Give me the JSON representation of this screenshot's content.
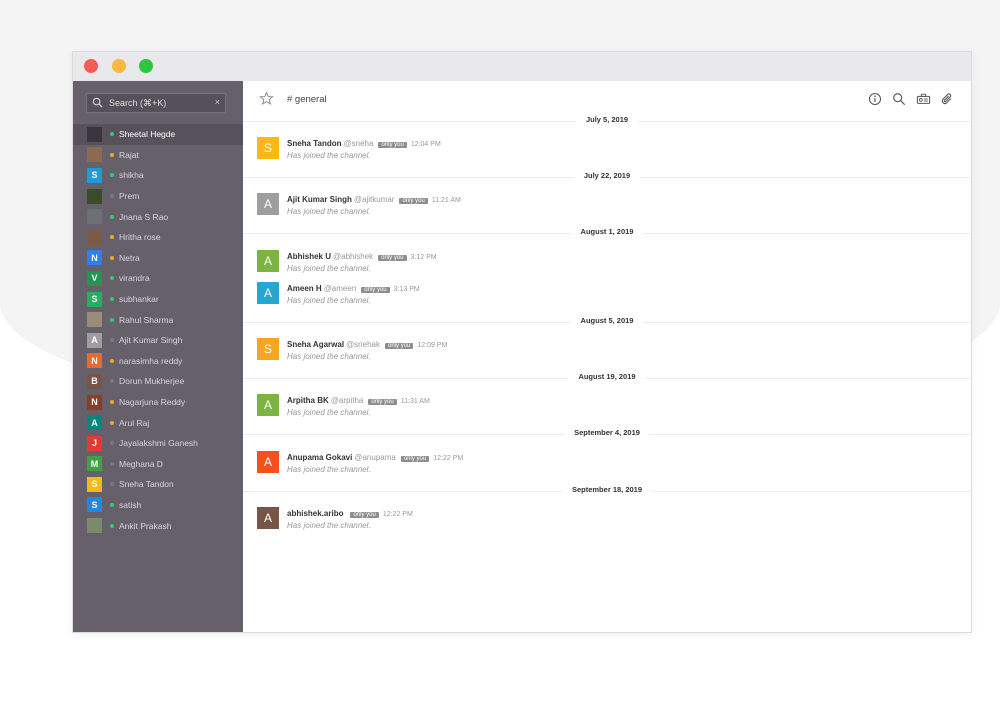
{
  "sidebar": {
    "search_placeholder": "Search (⌘+K)",
    "search_clear": "×",
    "dms": [
      {
        "name": "Sheetal Hegde",
        "avatar_letter": "",
        "avatar_color": "#3a3540",
        "status_color": "#2ecc71",
        "active": true
      },
      {
        "name": "Rajat",
        "avatar_letter": "",
        "avatar_color": "#8a6a50",
        "status_color": "#f5a623"
      },
      {
        "name": "shikha",
        "avatar_letter": "S",
        "avatar_color": "#1b9be0",
        "status_color": "#2ecc71"
      },
      {
        "name": "Prem",
        "avatar_letter": "",
        "avatar_color": "#3c4a2c",
        "status_color": "#7c7780"
      },
      {
        "name": "Jnana S Rao",
        "avatar_letter": "",
        "avatar_color": "#6d6f73",
        "status_color": "#2ecc71"
      },
      {
        "name": "Hritha rose",
        "avatar_letter": "",
        "avatar_color": "#7b5a4a",
        "status_color": "#f5a623"
      },
      {
        "name": "Netra",
        "avatar_letter": "N",
        "avatar_color": "#2f80ed",
        "status_color": "#f5a623"
      },
      {
        "name": "virandra",
        "avatar_letter": "V",
        "avatar_color": "#219653",
        "status_color": "#2ecc71"
      },
      {
        "name": "subhankar",
        "avatar_letter": "S",
        "avatar_color": "#27ae60",
        "status_color": "#2ecc71"
      },
      {
        "name": "Rahul Sharma",
        "avatar_letter": "",
        "avatar_color": "#9b8b7a",
        "status_color": "#2ecc71"
      },
      {
        "name": "Ajit Kumar Singh",
        "avatar_letter": "A",
        "avatar_color": "#9e9e9e",
        "status_color": "#7c7780"
      },
      {
        "name": "narasimha reddy",
        "avatar_letter": "N",
        "avatar_color": "#e96b2b",
        "status_color": "#f5a623"
      },
      {
        "name": "Dorun Mukherjee",
        "avatar_letter": "B",
        "avatar_color": "#795548",
        "status_color": "#7c7780"
      },
      {
        "name": "Nagarjuna Reddy",
        "avatar_letter": "N",
        "avatar_color": "#8d3c2a",
        "status_color": "#f5a623"
      },
      {
        "name": "Arul Raj",
        "avatar_letter": "A",
        "avatar_color": "#00897b",
        "status_color": "#f5a623"
      },
      {
        "name": "Jayalakshmi Ganesh",
        "avatar_letter": "J",
        "avatar_color": "#e53935",
        "status_color": "#7c7780"
      },
      {
        "name": "Meghana D",
        "avatar_letter": "M",
        "avatar_color": "#43a047",
        "status_color": "#7c7780"
      },
      {
        "name": "Sneha Tandon",
        "avatar_letter": "S",
        "avatar_color": "#f9b814",
        "status_color": "#7c7780"
      },
      {
        "name": "satish",
        "avatar_letter": "S",
        "avatar_color": "#1e88e5",
        "status_color": "#2ecc71"
      },
      {
        "name": "Ankit Prakash",
        "avatar_letter": "",
        "avatar_color": "#7a8a6a",
        "status_color": "#2ecc71"
      }
    ]
  },
  "header": {
    "channel": "# general"
  },
  "date_separators": [
    "July 5, 2019",
    "July 22, 2019",
    "August 1, 2019",
    "August 5, 2019",
    "August 19, 2019",
    "September 4, 2019",
    "September 18, 2019"
  ],
  "messages": [
    {
      "name": "Sneha Tandon",
      "username": "@sneha",
      "badge": "only you",
      "time": "12:04 PM",
      "text": "Has joined the channel.",
      "avatar_letter": "S",
      "avatar_color": "#f9b814"
    },
    {
      "name": "Ajit Kumar Singh",
      "username": "@ajitkumar",
      "badge": "only you",
      "time": "11:21 AM",
      "text": "Has joined the channel.",
      "avatar_letter": "A",
      "avatar_color": "#9e9e9e"
    },
    {
      "name": "Abhishek U",
      "username": "@abhishek",
      "badge": "only you",
      "time": "3:12 PM",
      "text": "Has joined the channel.",
      "avatar_letter": "A",
      "avatar_color": "#7cb342"
    },
    {
      "name": "Ameen H",
      "username": "@ameen",
      "badge": "only you",
      "time": "3:13 PM",
      "text": "Has joined the channel.",
      "avatar_letter": "A",
      "avatar_color": "#26a6d1"
    },
    {
      "name": "Sneha Agarwal",
      "username": "@snehak",
      "badge": "only you",
      "time": "12:09 PM",
      "text": "Has joined the channel.",
      "avatar_letter": "S",
      "avatar_color": "#f5a623"
    },
    {
      "name": "Arpitha BK",
      "username": "@arpitha",
      "badge": "only you",
      "time": "11:31 AM",
      "text": "Has joined the channel.",
      "avatar_letter": "A",
      "avatar_color": "#7cb342"
    },
    {
      "name": "Anupama Gokavi",
      "username": "@anupama",
      "badge": "only you",
      "time": "12:22 PM",
      "text": "Has joined the channel.",
      "avatar_letter": "A",
      "avatar_color": "#f4511e"
    },
    {
      "name": "abhishek.aribo",
      "username": "",
      "badge": "only you",
      "time": "12:22 PM",
      "text": "Has joined the channel.",
      "avatar_letter": "A",
      "avatar_color": "#795548"
    }
  ]
}
